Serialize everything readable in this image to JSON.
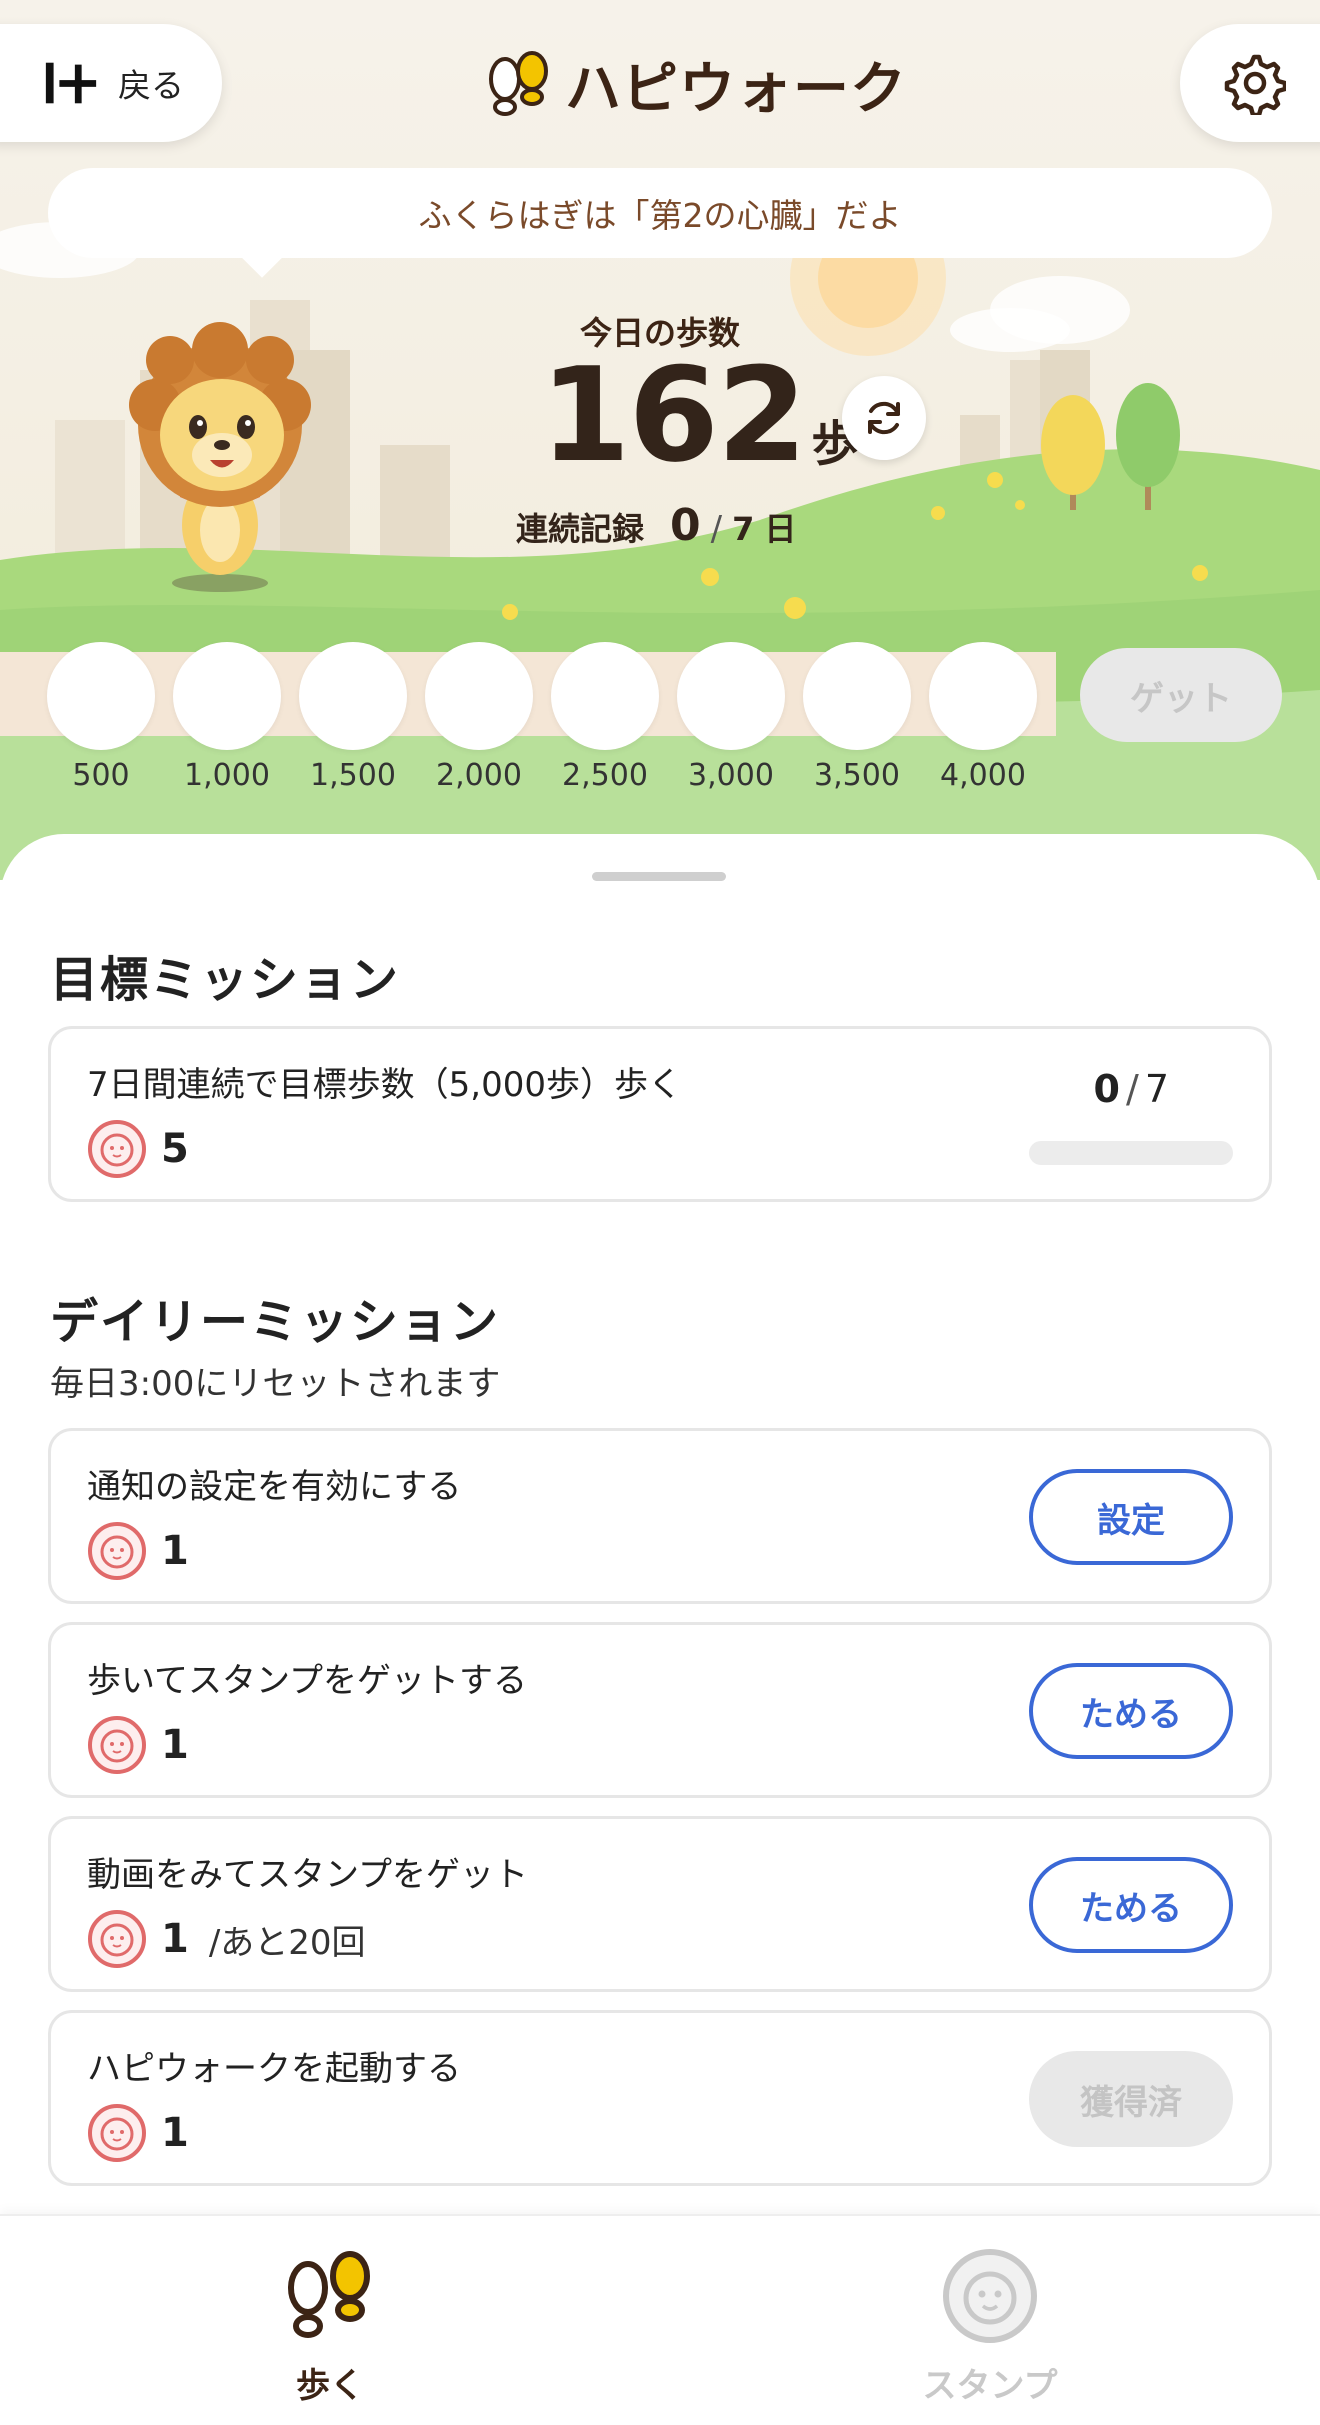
{
  "header": {
    "back_label": "戻る",
    "app_title": "ハピウォーク"
  },
  "tip_text": "ふくらはぎは「第2の心臓」だよ",
  "steps": {
    "label": "今日の歩数",
    "count": "162",
    "unit": "歩"
  },
  "streak": {
    "label": "連続記録",
    "current": "0",
    "separator": "/",
    "total": "7",
    "unit": "日"
  },
  "milestones": [
    "500",
    "1,000",
    "1,500",
    "2,000",
    "2,500",
    "3,000",
    "3,500",
    "4,000"
  ],
  "get_button": "ゲット",
  "goal_section": {
    "title": "目標ミッション",
    "missions": [
      {
        "title": "7日間連続で目標歩数（5,000歩）歩く",
        "reward": "5",
        "progress_current": "0",
        "progress_sep": "/",
        "progress_total": "7",
        "progress_fraction": 0
      }
    ]
  },
  "daily_section": {
    "title": "デイリーミッション",
    "subtitle": "毎日3:00にリセットされます",
    "missions": [
      {
        "title": "通知の設定を有効にする",
        "reward": "1",
        "extra": "",
        "action": "設定",
        "state": "active"
      },
      {
        "title": "歩いてスタンプをゲットする",
        "reward": "1",
        "extra": "",
        "action": "ためる",
        "state": "active"
      },
      {
        "title": "動画をみてスタンプをゲット",
        "reward": "1",
        "extra": "/あと20回",
        "action": "ためる",
        "state": "active"
      },
      {
        "title": "ハピウォークを起動する",
        "reward": "1",
        "extra": "",
        "action": "獲得済",
        "state": "done"
      }
    ]
  },
  "tabs": [
    {
      "label": "歩く",
      "icon": "footprints-icon",
      "active": true
    },
    {
      "label": "スタンプ",
      "icon": "lion-stamp-icon",
      "active": false
    }
  ],
  "colors": {
    "accent_blue": "#3a68d6",
    "brand_brown": "#3c2415",
    "brand_yellow": "#f0b400",
    "stamp_red": "#e06a6a"
  }
}
